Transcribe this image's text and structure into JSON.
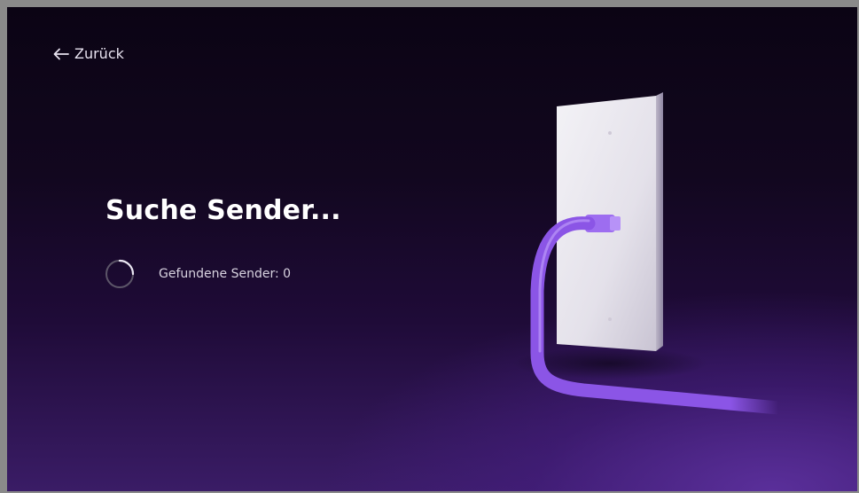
{
  "header": {
    "back_label": "Zurück",
    "back_icon": "arrow-left-icon"
  },
  "main": {
    "title": "Suche Sender...",
    "status_prefix": "Gefundene Sender:",
    "channels_found": "0",
    "spinner_icon": "loading-spinner-icon"
  },
  "illustration": {
    "name": "wall-plate-with-cable",
    "cable_color": "#8b55e6",
    "plate_color": "#e9e7ee"
  },
  "colors": {
    "background_top": "#0b0414",
    "background_bottom": "#3a1c66",
    "text_primary": "#ffffff",
    "text_secondary": "#d8d3e0"
  }
}
